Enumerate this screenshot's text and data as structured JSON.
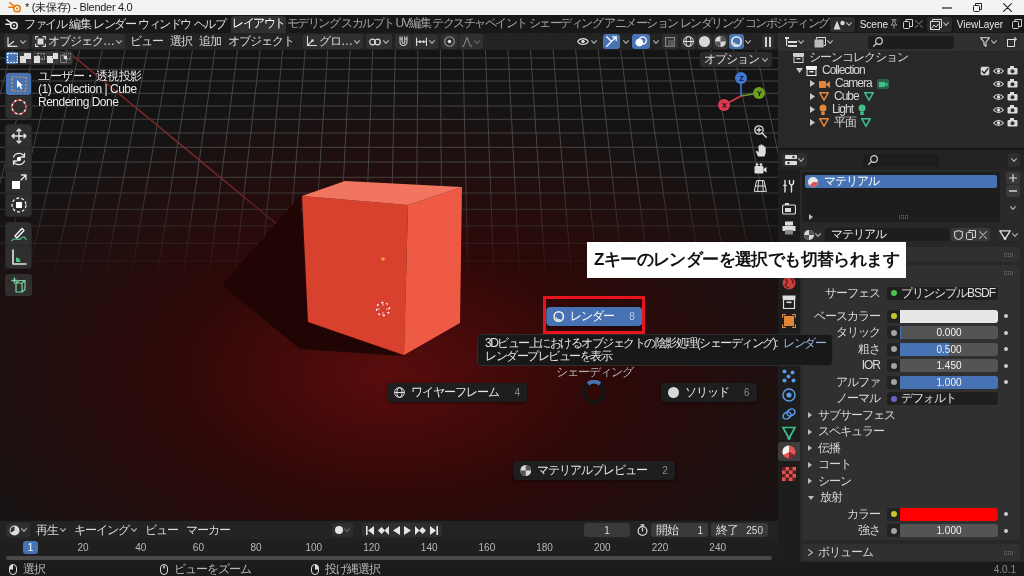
{
  "window": {
    "title": "* (未保存) - Blender 4.0"
  },
  "menu": [
    "ファイル",
    "編集",
    "レンダー",
    "ウィンドウ",
    "ヘルプ"
  ],
  "workspaces": [
    {
      "label": "レイアウト",
      "selected": true
    },
    {
      "label": "モデリング",
      "selected": false
    },
    {
      "label": "スカルプト",
      "selected": false
    },
    {
      "label": "UV編集",
      "selected": false
    },
    {
      "label": "テクスチャペイント",
      "selected": false
    },
    {
      "label": "シェーディング",
      "selected": false
    },
    {
      "label": "アニメーション",
      "selected": false
    },
    {
      "label": "レンダリング",
      "selected": false
    },
    {
      "label": "コンポジティング",
      "selected": false
    }
  ],
  "scene": {
    "name": "Scene"
  },
  "view_layer": {
    "name": "ViewLayer"
  },
  "viewport": {
    "header": {
      "mode": "オブジェク…",
      "menus": [
        "ビュー",
        "選択",
        "追加",
        "オブジェクト"
      ],
      "orientation": "グロ…",
      "toggles": [
        {
          "kind": "gizmos",
          "on": true
        },
        {
          "kind": "overlays",
          "on": true
        },
        {
          "kind": "xray",
          "on": false
        }
      ],
      "shading": [
        {
          "kind": "wireframe",
          "selected": false
        },
        {
          "kind": "solid",
          "selected": false
        },
        {
          "kind": "material",
          "selected": false
        },
        {
          "kind": "rendered",
          "selected": true
        }
      ]
    },
    "options": "オプション",
    "select_modes": [
      {
        "kind": "set",
        "selected": true
      },
      {
        "kind": "extend",
        "selected": false
      },
      {
        "kind": "subtract",
        "selected": false
      },
      {
        "kind": "invert",
        "selected": false
      },
      {
        "kind": "intersect",
        "selected": false
      }
    ],
    "tool_groups": [
      [
        {
          "kind": "select",
          "selected": true
        },
        {
          "kind": "cursor",
          "selected": false
        }
      ],
      [
        {
          "kind": "move",
          "selected": false
        },
        {
          "kind": "rotate",
          "selected": false
        },
        {
          "kind": "scale",
          "selected": false
        },
        {
          "kind": "transform",
          "selected": false
        }
      ],
      [
        {
          "kind": "annotate",
          "selected": false
        },
        {
          "kind": "measure",
          "selected": false
        }
      ],
      [
        {
          "kind": "add_cube",
          "selected": false
        }
      ]
    ],
    "info": [
      "ユーザー・透視投影",
      "(1) Collection | Cube",
      "Rendering Done"
    ],
    "axes": [
      {
        "label": "Z",
        "color": "#3f78d8"
      },
      {
        "label": "Y",
        "color": "#6c9d1f"
      },
      {
        "label": "X",
        "color": "#d83a52"
      }
    ],
    "pie": {
      "title": "シェーディング",
      "items": [
        {
          "kind": "rendered",
          "label": "レンダー",
          "key": "8",
          "selected": true
        },
        {
          "kind": "wireframe",
          "label": "ワイヤーフレーム",
          "key": "4",
          "selected": false
        },
        {
          "kind": "solid",
          "label": "ソリッド",
          "key": "6",
          "selected": false
        },
        {
          "kind": "material",
          "label": "マテリアルプレビュー",
          "key": "2",
          "selected": false
        }
      ]
    },
    "tooltip": {
      "text": "3Dビュー上におけるオブジェクトの陰影処理(シェーディング):",
      "value": "レンダー",
      "detail": "レンダープレビューを表示"
    },
    "callout": "Zキーのレンダーを選択でも切替られます"
  },
  "timeline": {
    "menus": [
      {
        "label": "再生",
        "dropdown": true
      },
      {
        "label": "キーイング",
        "dropdown": true
      },
      {
        "label": "ビュー",
        "dropdown": false
      },
      {
        "label": "マーカー",
        "dropdown": false
      }
    ],
    "frame": "1",
    "start_label": "開始",
    "start": "1",
    "end_label": "終了",
    "end": "250",
    "playhead": "1",
    "ticks": [
      "20",
      "40",
      "60",
      "80",
      "100",
      "120",
      "140",
      "160",
      "180",
      "200",
      "220",
      "240"
    ]
  },
  "outliner": {
    "tree": [
      {
        "kind": "scene_collection",
        "label": "シーンコレクション",
        "children": [
          {
            "kind": "collection",
            "label": "Collection",
            "expanded": true,
            "checked": true,
            "children": [
              {
                "kind": "camera",
                "label": "Camera",
                "expanded": false
              },
              {
                "kind": "mesh",
                "label": "Cube",
                "expanded": false
              },
              {
                "kind": "light",
                "label": "Light",
                "expanded": false
              },
              {
                "kind": "mesh",
                "label": "平面",
                "expanded": false
              }
            ]
          }
        ]
      }
    ]
  },
  "properties": {
    "tab_groups": [
      [
        {
          "kind": "tool",
          "selected": false
        }
      ],
      [
        {
          "kind": "render",
          "selected": false
        },
        {
          "kind": "output",
          "selected": false
        }
      ],
      [
        {
          "kind": "world",
          "selected": false
        },
        {
          "kind": "collection",
          "selected": false
        },
        {
          "kind": "object",
          "selected": false
        }
      ],
      [
        {
          "kind": "particles",
          "selected": false
        },
        {
          "kind": "physics",
          "selected": false
        },
        {
          "kind": "constraints",
          "selected": false
        },
        {
          "kind": "data",
          "selected": false
        }
      ],
      [
        {
          "kind": "material",
          "selected": true
        }
      ],
      [
        {
          "kind": "texture",
          "selected": false
        }
      ]
    ],
    "slots": [
      {
        "label": "マテリアル",
        "selected": true
      }
    ],
    "material": "マテリアル",
    "surface": [
      {
        "kind": "shader",
        "label": "サーフェス",
        "value": "プリンシプルBSDF",
        "color": "#4fc24f"
      },
      {
        "kind": "color",
        "label": "ベースカラー",
        "color": "#c7c729",
        "swatch": {
          "color": "#e6e6e6"
        }
      },
      {
        "kind": "slider",
        "label": "タリック",
        "value": "0.000",
        "level": 0,
        "color": "#a1a1a1"
      },
      {
        "kind": "slider",
        "label": "粗さ",
        "value": "0.500",
        "level": 0.5,
        "color": "#a1a1a1"
      },
      {
        "kind": "number",
        "label": "IOR",
        "value": "1.450",
        "color": "#a1a1a1"
      },
      {
        "kind": "slider",
        "label": "アルファ",
        "value": "1.000",
        "level": 1,
        "color": "#a1a1a1"
      },
      {
        "kind": "vector",
        "label": "ノーマル",
        "value": "デフォルト",
        "color": "#6363c7"
      }
    ],
    "subpanels": [
      {
        "label": "サブサーフェス",
        "expanded": false
      },
      {
        "label": "スペキュラー",
        "expanded": false
      },
      {
        "label": "伝播",
        "expanded": false
      },
      {
        "label": "コート",
        "expanded": false
      },
      {
        "label": "シーン",
        "expanded": false
      },
      {
        "label": "放射",
        "expanded": true,
        "rows": [
          {
            "kind": "color",
            "label": "カラー",
            "color": "#c7c729",
            "swatch": {
              "color": "#ff0000"
            }
          },
          {
            "kind": "number",
            "label": "強さ",
            "value": "1.000",
            "color": "#a1a1a1"
          }
        ]
      }
    ],
    "volume": {
      "label": "ボリューム",
      "expanded": false
    }
  },
  "status_bar": {
    "hints": [
      {
        "kind": "left_click",
        "label": "選択"
      },
      {
        "kind": "middle_click",
        "label": "ビューをズーム"
      },
      {
        "kind": "right_click",
        "label": "投げ縄選択"
      }
    ],
    "version": "4.0.1"
  }
}
